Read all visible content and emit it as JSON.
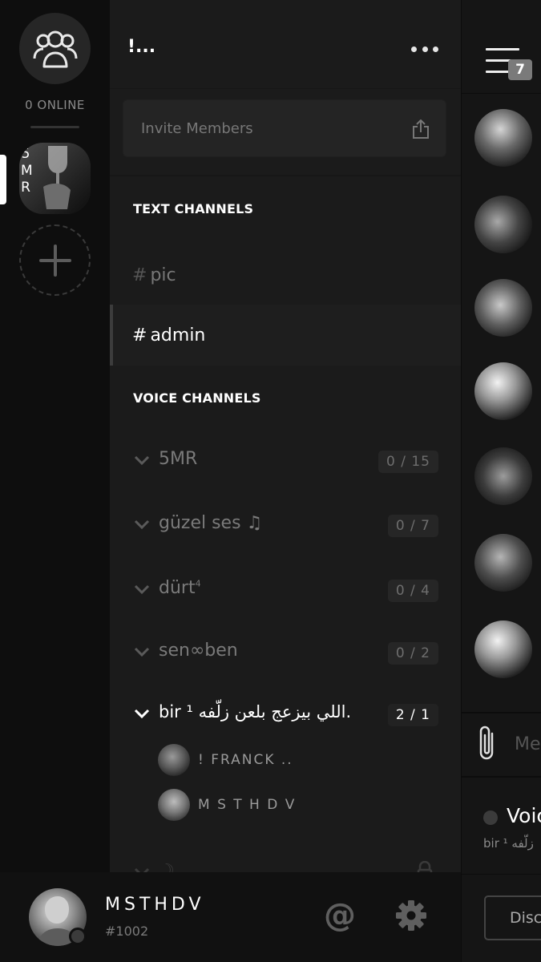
{
  "rail": {
    "online_label": "0 ONLINE",
    "server_initials": [
      "5",
      "M",
      "R"
    ]
  },
  "server": {
    "name": "!..."
  },
  "invite": {
    "label": "Invite Members"
  },
  "text_category": "TEXT CHANNELS",
  "text_channels": [
    {
      "hash": "#",
      "name": "pic",
      "active": false
    },
    {
      "hash": "#",
      "name": "admin",
      "active": true
    }
  ],
  "voice_category": "VOICE CHANNELS",
  "voice_channels": [
    {
      "name": "5MR",
      "count": "0 / 15"
    },
    {
      "name": "güzel ses ♫",
      "count": "0 / 7"
    },
    {
      "name": "dürt",
      "sup": "4",
      "count": "0 / 4"
    },
    {
      "name": "sen∞ben",
      "count": "0 / 2"
    },
    {
      "name": "bir ¹ اللي بيزعج بلعن زلّفه.",
      "count": "2 / 1"
    },
    {
      "name": "☽",
      "count": ""
    }
  ],
  "voice_members": [
    {
      "name": "! FRANCK .."
    },
    {
      "name": "M S T H D V"
    }
  ],
  "member_column": {
    "badge": "7",
    "message_placeholder": "Me",
    "voice_title": "Voic",
    "voice_sub": "bir ¹ زلّفه",
    "disconnect_label": "Disc"
  },
  "user": {
    "name": "MSTHDV",
    "discriminator": "#1002",
    "mention_symbol": "@"
  },
  "colors": {
    "background": "#1b1b1b",
    "rail": "#0e0e0e",
    "text": "#ffffff",
    "muted": "#777777"
  }
}
